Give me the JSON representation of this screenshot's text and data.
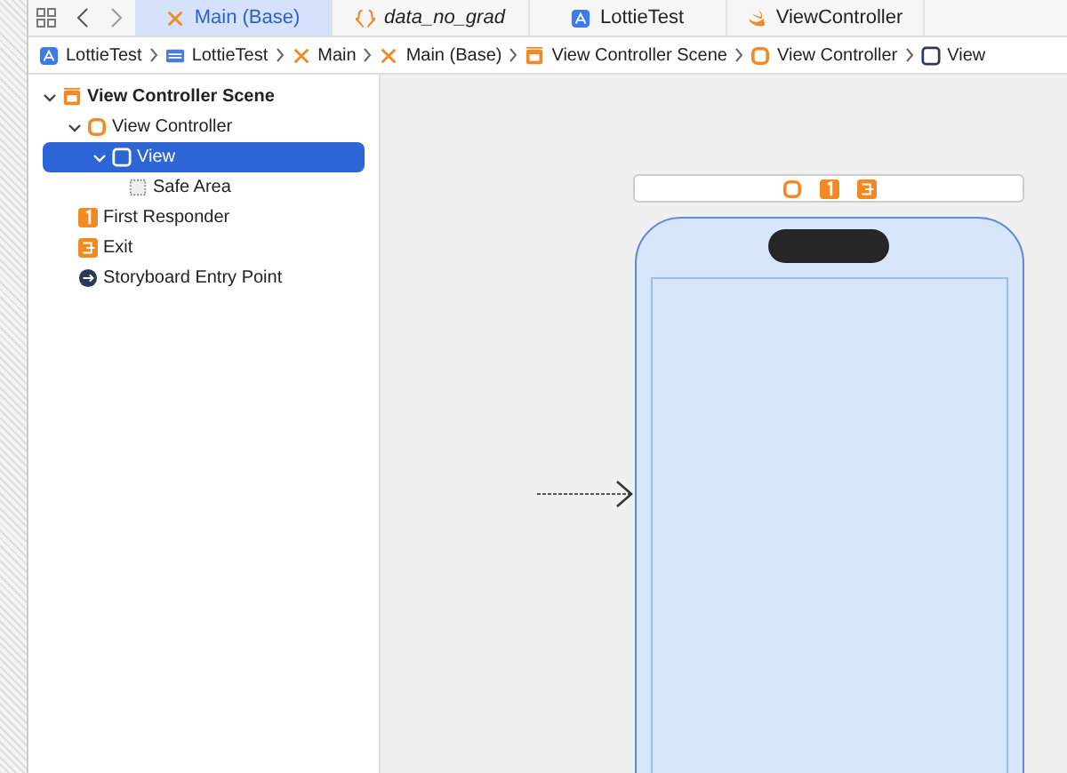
{
  "tabs": [
    {
      "label": "Main (Base)",
      "kind": "storyboard",
      "selected": true
    },
    {
      "label": "data_no_grad",
      "kind": "json",
      "selected": false
    },
    {
      "label": "LottieTest",
      "kind": "app",
      "selected": false
    },
    {
      "label": "ViewController",
      "kind": "swift",
      "selected": false
    }
  ],
  "breadcrumbs": [
    {
      "label": "LottieTest",
      "kind": "app"
    },
    {
      "label": "LottieTest",
      "kind": "folder"
    },
    {
      "label": "Main",
      "kind": "storyboard"
    },
    {
      "label": "Main (Base)",
      "kind": "storyboard"
    },
    {
      "label": "View Controller Scene",
      "kind": "scene"
    },
    {
      "label": "View Controller",
      "kind": "controller"
    },
    {
      "label": "View",
      "kind": "view"
    }
  ],
  "outline": [
    {
      "label": "View Controller Scene",
      "kind": "scene",
      "expanded": true,
      "selected": false,
      "children": [
        {
          "label": "View Controller",
          "kind": "controller",
          "expanded": true,
          "selected": false,
          "children": [
            {
              "label": "View",
              "kind": "view",
              "expanded": true,
              "selected": true,
              "children": [
                {
                  "label": "Safe Area",
                  "kind": "safe",
                  "selected": false
                }
              ]
            }
          ]
        },
        {
          "label": "First Responder",
          "kind": "responder",
          "selected": false
        },
        {
          "label": "Exit",
          "kind": "exit",
          "selected": false
        },
        {
          "label": "Storyboard Entry Point",
          "kind": "entry",
          "selected": false
        }
      ]
    }
  ]
}
